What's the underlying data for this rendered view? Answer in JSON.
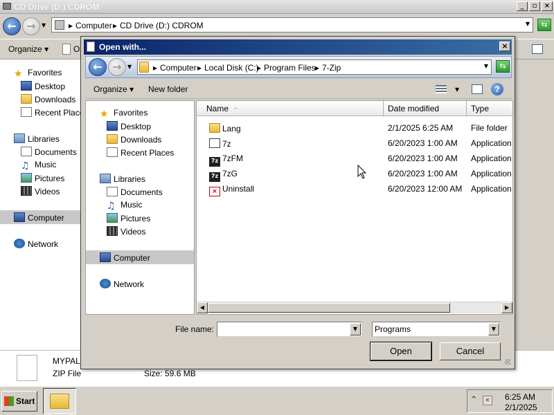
{
  "background_window": {
    "title": "CD Drive (D:) CDROM",
    "breadcrumb": [
      "Computer",
      "CD Drive (D:) CDROM"
    ],
    "toolbar": {
      "organize": "Organize",
      "partial_item": "O"
    },
    "nav": {
      "favorites": "Favorites",
      "desktop": "Desktop",
      "downloads": "Downloads",
      "recent_places": "Recent Places",
      "libraries": "Libraries",
      "documents": "Documents",
      "music": "Music",
      "pictures": "Pictures",
      "videos": "Videos",
      "computer": "Computer",
      "network": "Network"
    },
    "details": {
      "file_name": "MYPAL_",
      "file_type": "ZIP File",
      "size": "Size: 59.6 MB"
    }
  },
  "dialog": {
    "title": "Open with...",
    "breadcrumb": [
      "Computer",
      "Local Disk (C:)",
      "Program Files",
      "7-Zip"
    ],
    "toolbar": {
      "organize": "Organize",
      "new_folder": "New folder"
    },
    "nav": {
      "favorites": "Favorites",
      "desktop": "Desktop",
      "downloads": "Downloads",
      "recent_places": "Recent Places",
      "libraries": "Libraries",
      "documents": "Documents",
      "music": "Music",
      "pictures": "Pictures",
      "videos": "Videos",
      "computer": "Computer",
      "network": "Network"
    },
    "columns": {
      "name": "Name",
      "date_modified": "Date modified",
      "type": "Type"
    },
    "files": [
      {
        "name": "Lang",
        "date": "2/1/2025 6:25 AM",
        "type": "File folder",
        "icon": "folder-icon"
      },
      {
        "name": "7z",
        "date": "6/20/2023 1:00 AM",
        "type": "Application",
        "icon": "app-icon"
      },
      {
        "name": "7zFM",
        "date": "6/20/2023 1:00 AM",
        "type": "Application",
        "icon": "7zip-icon"
      },
      {
        "name": "7zG",
        "date": "6/20/2023 1:00 AM",
        "type": "Application",
        "icon": "7zip-icon"
      },
      {
        "name": "Uninstall",
        "date": "6/20/2023 12:00 AM",
        "type": "Application",
        "icon": "uninstall-icon"
      }
    ],
    "file_name_label": "File name:",
    "file_name_value": "",
    "filter_value": "Programs",
    "open_label": "Open",
    "cancel_label": "Cancel"
  },
  "taskbar": {
    "start_label": "Start",
    "time": "6:25 AM",
    "date": "2/1/2025"
  }
}
